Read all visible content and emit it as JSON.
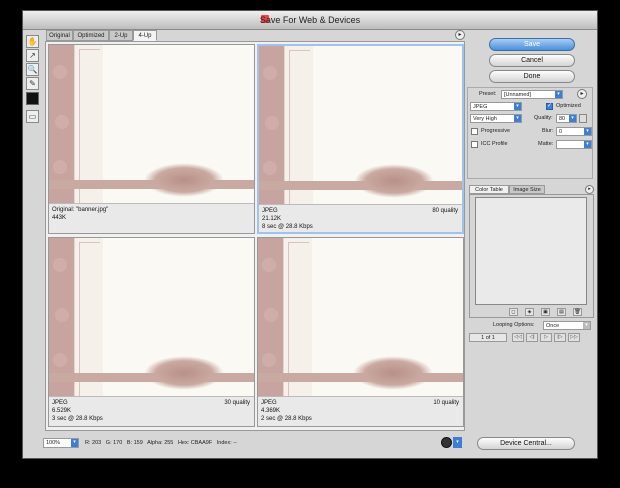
{
  "window": {
    "title": "Save For Web & Devices"
  },
  "tabs": [
    "Original",
    "Optimized",
    "2-Up",
    "4-Up"
  ],
  "active_tab": "4-Up",
  "panes": [
    {
      "line1": "Original: \"banner.jpg\"",
      "line2": "443K",
      "line3": "",
      "right": ""
    },
    {
      "line1": "JPEG",
      "line2": "21.12K",
      "line3": "8 sec @ 28.8 Kbps",
      "right": "80 quality"
    },
    {
      "line1": "JPEG",
      "line2": "6.529K",
      "line3": "3 sec @ 28.8 Kbps",
      "right": "30 quality"
    },
    {
      "line1": "JPEG",
      "line2": "4.369K",
      "line3": "2 sec @ 28.8 Kbps",
      "right": "10 quality"
    }
  ],
  "buttons": {
    "save": "Save",
    "cancel": "Cancel",
    "done": "Done",
    "device_central": "Device Central..."
  },
  "settings": {
    "preset_label": "Preset:",
    "preset_value": "[Unnamed]",
    "format": "JPEG",
    "optimized_label": "Optimized",
    "compression": "Very High",
    "quality_label": "Quality:",
    "quality_value": "80",
    "progressive_label": "Progressive",
    "blur_label": "Blur:",
    "blur_value": "0",
    "icc_label": "ICC Profile",
    "matte_label": "Matte:",
    "matte_value": ""
  },
  "color_panel": {
    "tab_color_table": "Color Table",
    "tab_image_size": "Image Size"
  },
  "looping": {
    "label": "Looping Options:",
    "value": "Once"
  },
  "animation": {
    "frame": "1 of 1"
  },
  "status": {
    "zoom": "100%",
    "readout": "R: 203   G: 170   B: 159   Alpha: 255   Hex: CBAA9F   Index: --"
  }
}
